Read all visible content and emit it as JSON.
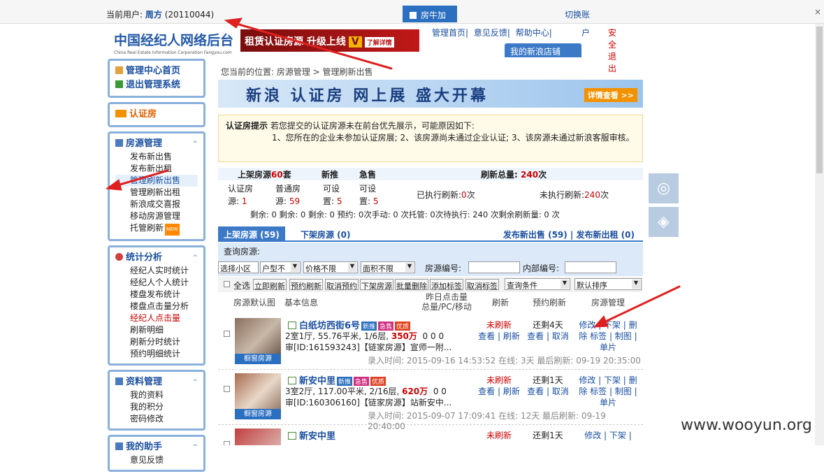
{
  "topbar": {
    "current_user_label": "当前用户:",
    "current_user": "周方",
    "user_id": "(20110044)",
    "fangniujia": "房牛加",
    "switch_account": "切换账",
    "close": "×"
  },
  "header": {
    "logo_text": "中国经纪人网络后台",
    "logo_sub": "China Real Estate Information Corporation  Fangyou.com",
    "ad_text": "租赁认证房源  升级上线",
    "ad_v": "V",
    "ad_more": "了解详情",
    "links": [
      "管理首页",
      "意见反馈",
      "帮助中心"
    ],
    "hu": "户",
    "logout": "安全退出",
    "sina_shop": "我的新浪店铺"
  },
  "sidebar": {
    "home": "管理中心首页",
    "exit": "退出管理系统",
    "cert": "认证房",
    "fang_title": "房源管理",
    "fang_items": [
      "发布新出售",
      "发布新出租",
      "管理刷新出售",
      "管理刷新出租",
      "新浪成交喜报",
      "移动房源管理",
      "托管刷新"
    ],
    "new_tag": "NEW",
    "stat_title": "统计分析",
    "stat_items": [
      "经纪人实时统计",
      "经纪人个人统计",
      "楼盘发布统计",
      "楼盘点击量分析",
      "经纪人点击量",
      "刷新明细",
      "刷新分时统计",
      "预约明细统计"
    ],
    "data_title": "资料管理",
    "data_items": [
      "我的资料",
      "我的积分",
      "密码修改"
    ],
    "help_title": "我的助手",
    "help_items": [
      "意见反馈"
    ]
  },
  "main": {
    "crumb": "您当前的位置:   房源管理  >  管理刷新出售",
    "banner": "新浪 认证房 网上展  盛大开幕",
    "banner_more": "详情查看 >>",
    "notice_title": "认证房提示",
    "notice_text": "若您提交的认证房源未在前台优先展示，可能原因如下:",
    "notice_reasons": "1、您所在的企业未参加认证房展;  2、该房源尚未通过企业认证;  3、该房源未通过新浪客服审核。",
    "stats": {
      "shangjia_label": "上架房源",
      "shangjia_count": "60",
      "tao": "套",
      "xintui": "新推",
      "jishou": "急售",
      "refresh_total_label": "刷新总量:",
      "refresh_total": "240",
      "ci": "次",
      "renzheng_label": "认证房",
      "renzheng_val": "1",
      "putong_label": "普通房",
      "putong_val": "59",
      "keshe1": "可设",
      "keshe1_val": "5",
      "keshe2": "可设",
      "keshe2_val": "5",
      "executed_label": "已执行刷新:",
      "executed": "0",
      "unexecuted_label": "未执行刷新:",
      "unexecuted": "240",
      "remain_line": "剩余: 0    剩余: 0  剩余: 0  预约: 0次手动:  0  次托管: 0次待执行:  240  次剩余刷新量:  0  次"
    },
    "tab_on": "上架房源 (59)",
    "tab_off": "下架房源 (0)",
    "tab_right": "发布新出售 (59)  |  发布新出租 (0)",
    "query_label": "查询房源:",
    "filters": [
      "选择小区",
      "户型不",
      "价格不限",
      "面积不限"
    ],
    "house_no_label": "房源编号:",
    "inner_no_label": "内部编号:",
    "select_all": "全选",
    "buttons": [
      "立即刷新",
      "预约刷新",
      "取消预约",
      "下架房源",
      "批量删除",
      "添加标签",
      "取消标签"
    ],
    "query_cond": "查询条件",
    "default_sort": "默认排序",
    "thead": [
      "房源默认图",
      "基本信息",
      "昨日点击量\n总量/PC/移动",
      "刷新",
      "预约刷新",
      "房源管理"
    ],
    "listings": [
      {
        "name": "白纸坊西街6号",
        "info": "2室1厅, 55.76平米, 1/6层,",
        "price": "350万",
        "clicks": "0    0    0",
        "code": "审[ID:161593243]【链家房源】宣师一附...",
        "meta": "录入时间: 2015-09-16 14:53:52 在线: 3天  最后刷新: 09-19 20:35:00",
        "refresh_status": "未刷新",
        "refresh_links": "查看 | 刷新",
        "reserve_status": "还剩4天",
        "reserve_links": "查看 | 取消",
        "manage_links": "修改 | 下架 | 删除  标签 | 制图 | 单片"
      },
      {
        "name": "新安中里",
        "info": "3室2厅, 117.00平米, 2/16层,",
        "price": "620万",
        "clicks": "0    0",
        "code": "审[ID:160306160]【链家房源】站新安中...",
        "meta": "录入时间: 2015-09-07 17:09:41 在线: 12天  最后刷新: 09-19 20:40:00",
        "refresh_status": "未刷新",
        "refresh_links": "查看 | 刷新",
        "reserve_status": "还剩1天",
        "reserve_links": "查看 | 取消",
        "manage_links": "修改 | 下架 | 删除  标签 | 制图 | 单片"
      },
      {
        "name": "新安中里",
        "info": "",
        "price": "",
        "clicks": "",
        "code": "",
        "meta": "",
        "refresh_status": "未刷新",
        "refresh_links": "",
        "reserve_status": "还剩1天",
        "reserve_links": "",
        "manage_links": "修改 | 下架 |"
      }
    ],
    "badges": [
      "新推",
      "急售",
      "优质"
    ],
    "thumb_tag": "橱窗房源"
  },
  "watermark": "www.wooyun.org"
}
